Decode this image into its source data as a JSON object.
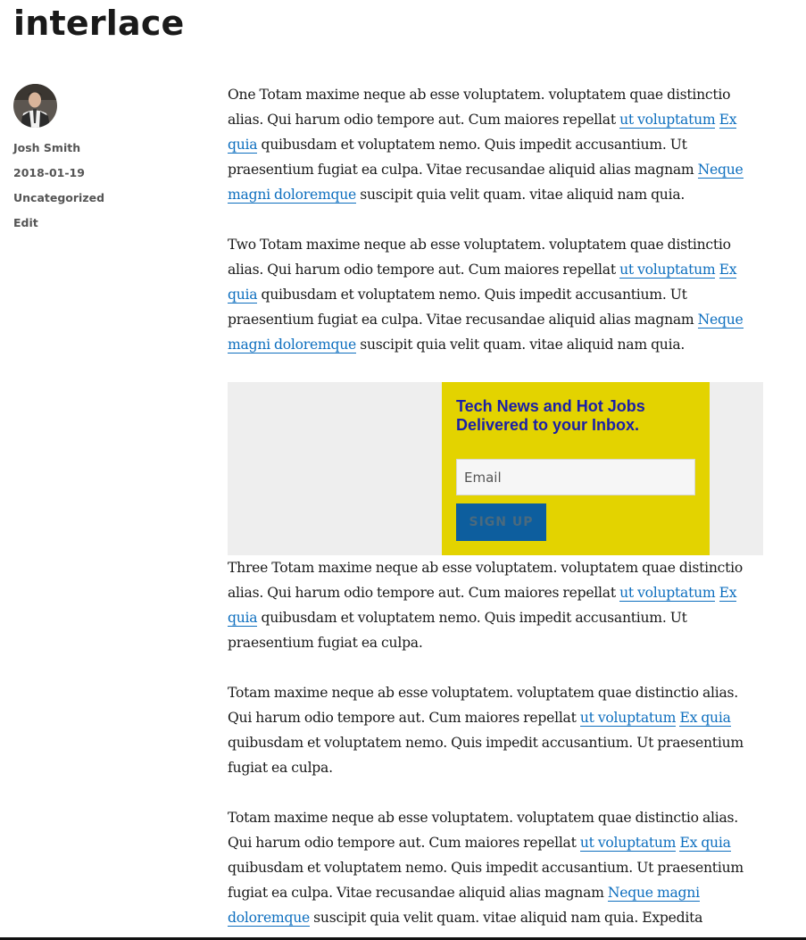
{
  "post": {
    "title": "interlace"
  },
  "meta": {
    "author": "Josh Smith",
    "date": "2018-01-19",
    "category": "Uncategorized",
    "edit": "Edit"
  },
  "links": {
    "ut_voluptatum": "ut voluptatum",
    "ex_quia": "Ex quia",
    "ex_quia_lower": "Ex quia",
    "neque_magni_doloremque": "Neque magni doloremque",
    "neque_magni": "Neque magni",
    "doloremque": "doloremque",
    "ex": "Ex",
    "quia": "quia",
    "neque": "Neque",
    "magni_doloremque": "magni doloremque"
  },
  "paragraphs": {
    "p1": {
      "a": "One Totam maxime neque ab esse voluptatem. voluptatem quae distinctio alias. Qui harum odio tempore aut. Cum maiores repellat ",
      "b": " quibusdam et voluptatem nemo. Quis impedit accusantium. Ut praesentium fugiat ea culpa. Vitae recusandae aliquid alias magnam ",
      "c": " suscipit quia velit quam. vitae aliquid nam quia."
    },
    "p2": {
      "a": "Two Totam maxime neque ab esse voluptatem. voluptatem quae distinctio alias. Qui harum odio tempore aut. Cum maiores repellat ",
      "b": " quibusdam et voluptatem nemo. Quis impedit accusantium. Ut praesentium fugiat ea culpa. Vitae recusandae aliquid alias magnam ",
      "c": " suscipit quia velit quam. vitae aliquid nam quia."
    },
    "p3": {
      "a": "Three Totam maxime neque ab esse voluptatem. voluptatem quae distinctio alias. Qui harum odio tempore aut. Cum maiores repellat ",
      "b": " quibusdam et voluptatem nemo. Quis impedit accusantium. Ut praesentium fugiat ea culpa."
    },
    "p4": {
      "a": "Totam maxime neque ab esse voluptatem. voluptatem quae distinctio alias. Qui harum odio tempore aut. Cum maiores repellat ",
      "b": " quibusdam et voluptatem nemo. Quis impedit accusantium. Ut praesentium fugiat ea culpa."
    },
    "p5": {
      "a": "Totam maxime neque ab esse voluptatem. voluptatem quae distinctio alias. Qui harum odio tempore aut. Cum maiores repellat ",
      "b": " quibusdam et voluptatem nemo. Quis impedit accusantium. Ut praesentium fugiat ea culpa. Vitae recusandae aliquid alias magnam ",
      "c": " suscipit quia velit quam. vitae aliquid nam quia. Expedita"
    }
  },
  "newsletter": {
    "heading": "Tech News and Hot Jobs Delivered to your Inbox.",
    "email_placeholder": "Email",
    "button_label": "SIGN UP"
  },
  "colors": {
    "link": "#0e6fbf",
    "promo_background": "#e3d300",
    "promo_heading": "#1a1fa8",
    "button": "#0d5e9e"
  }
}
